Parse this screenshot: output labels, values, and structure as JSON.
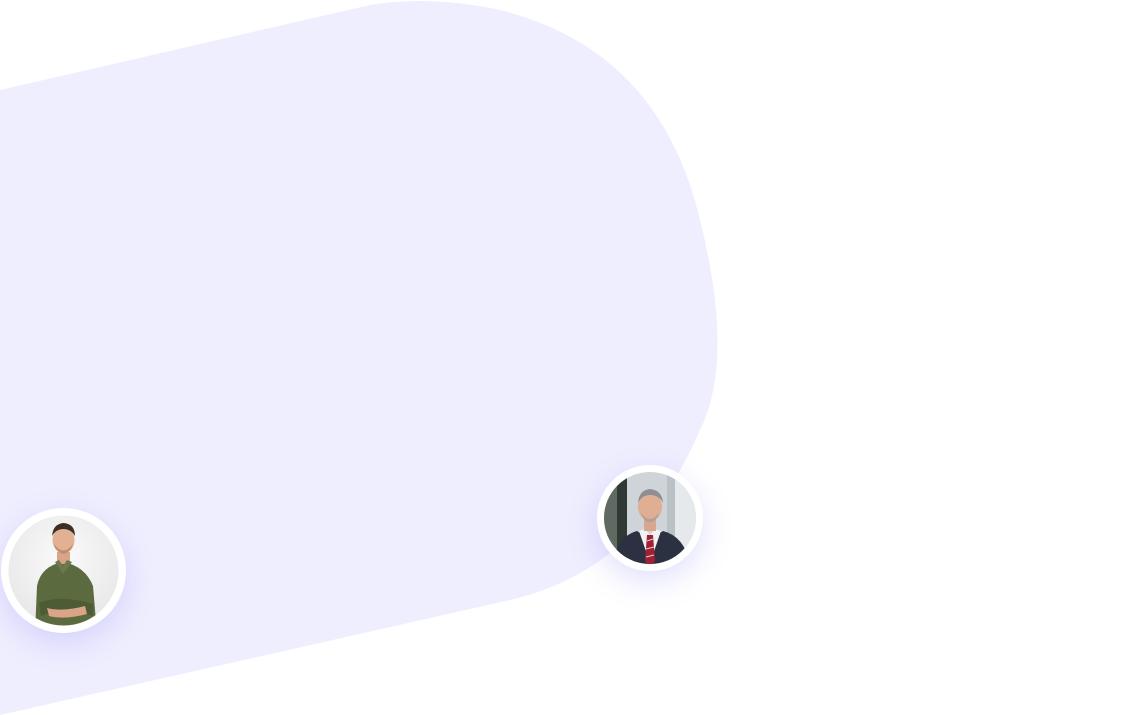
{
  "colors": {
    "background": "#ffffff",
    "blob": "#efeefe",
    "avatar_ring": "#ffffff",
    "shadow": "#7873f5"
  },
  "avatars": [
    {
      "name": "casual-man",
      "icon": "person-photo"
    },
    {
      "name": "business-man",
      "icon": "person-photo"
    }
  ]
}
